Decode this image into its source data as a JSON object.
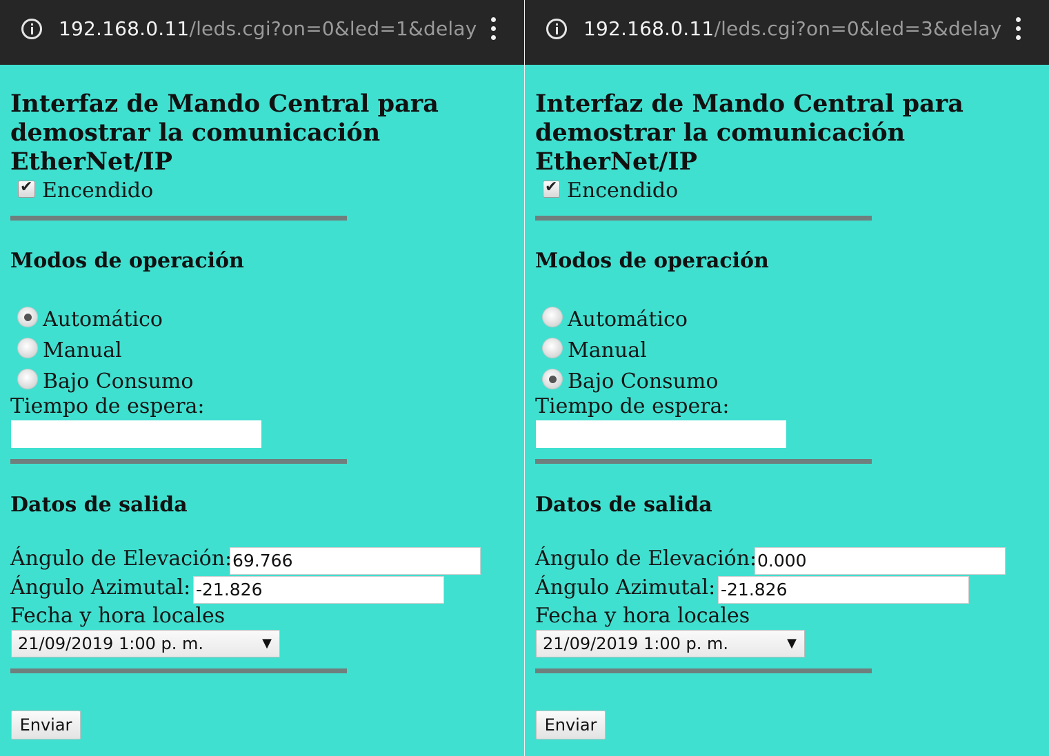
{
  "panels": [
    {
      "url_host": "192.168.0.11",
      "url_path": "/leds.cgi?on=0&led=1&delay",
      "title": "Interfaz de Mando Central para demostrar la comunicación EtherNet/IP",
      "power": {
        "label": "Encendido",
        "checked": true
      },
      "modes_heading": "Modos de operación",
      "modes": [
        {
          "label": "Automático",
          "selected": true
        },
        {
          "label": "Manual",
          "selected": false
        },
        {
          "label": "Bajo Consumo",
          "selected": false
        }
      ],
      "wait_label": "Tiempo de espera:",
      "wait_value": "",
      "output_heading": "Datos de salida",
      "elevation_label": "Ángulo de Elevación:",
      "elevation_value": "69.766",
      "azimuth_label": "Ángulo Azimutal:",
      "azimuth_value": "-21.826",
      "datetime_label": "Fecha y hora locales",
      "datetime_value": "21/09/2019 1:00 p. m.",
      "submit_label": "Enviar"
    },
    {
      "url_host": "192.168.0.11",
      "url_path": "/leds.cgi?on=0&led=3&delay",
      "title": "Interfaz de Mando Central para demostrar la comunicación EtherNet/IP",
      "power": {
        "label": "Encendido",
        "checked": true
      },
      "modes_heading": "Modos de operación",
      "modes": [
        {
          "label": "Automático",
          "selected": false
        },
        {
          "label": "Manual",
          "selected": false
        },
        {
          "label": "Bajo Consumo",
          "selected": true
        }
      ],
      "wait_label": "Tiempo de espera:",
      "wait_value": "",
      "output_heading": "Datos de salida",
      "elevation_label": "Ángulo de Elevación:",
      "elevation_value": "0.000",
      "azimuth_label": "Ángulo Azimutal:",
      "azimuth_value": "-21.826",
      "datetime_label": "Fecha y hora locales",
      "datetime_value": "21/09/2019 1:00 p. m.",
      "submit_label": "Enviar"
    }
  ],
  "icons": {
    "info": "info-icon",
    "menu": "more-vert-icon",
    "dropdown": "dropdown-arrow-icon"
  },
  "colors": {
    "page_bg": "#40e0d0",
    "urlbar_bg": "#262626",
    "rule": "#6f7f7d"
  }
}
